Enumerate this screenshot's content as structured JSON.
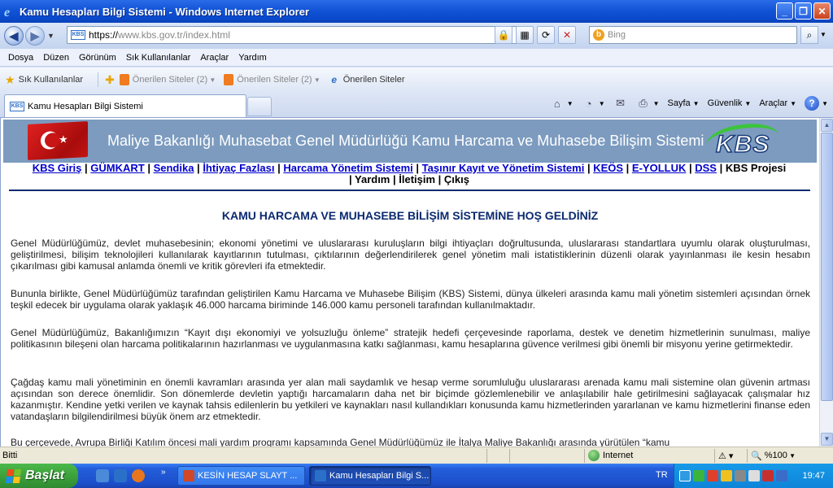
{
  "window": {
    "title": "Kamu Hesapları Bilgi Sistemi - Windows Internet Explorer",
    "min": "_",
    "max": "❐",
    "close": "✕"
  },
  "address": {
    "url_proto": "https://",
    "url_rest": "www.kbs.gov.tr/index.html",
    "search_placeholder": "Bing"
  },
  "menu": [
    "Dosya",
    "Düzen",
    "Görünüm",
    "Sık Kullanılanlar",
    "Araçlar",
    "Yardım"
  ],
  "favorites": {
    "label": "Sık Kullanılanlar",
    "items": [
      "Önerilen Siteler (2)",
      "Önerilen Siteler (2)",
      "Önerilen Siteler"
    ]
  },
  "tab": {
    "title": "Kamu Hesapları Bilgi Sistemi",
    "favicon": "KBS"
  },
  "commandbar": {
    "page": "Sayfa",
    "safety": "Güvenlik",
    "tools": "Araçlar",
    "help": "?"
  },
  "banner": {
    "title": "Maliye Bakanlığı Muhasebat Genel Müdürlüğü Kamu Harcama ve Muhasebe Bilişim Sistemi",
    "logo": "KBS"
  },
  "nav": {
    "links": [
      "KBS Giriş",
      "GÜMKART",
      "Sendika",
      "İhtiyaç Fazlası",
      "Harcama Yönetim Sistemi",
      "Taşınır Kayıt ve Yönetim Sistemi",
      "KEÖS",
      "E-YOLLUK",
      "DSS"
    ],
    "plain1": "KBS Projesi",
    "plain2": [
      "Yardım",
      "İletişim",
      "Çıkış"
    ],
    "sep": " | "
  },
  "welcome": "KAMU HARCAMA VE MUHASEBE BİLİŞİM SİSTEMİNE HOŞ GELDİNİZ",
  "paragraphs": [
    "Genel Müdürlüğümüz, devlet muhasebesinin; ekonomi yönetimi ve uluslararası kuruluşların bilgi ihtiyaçları doğrultusunda, uluslararası standartlara uyumlu olarak oluşturulması, geliştirilmesi, bilişim teknolojileri kullanılarak kayıtlarının tutulması, çıktılarının değerlendirilerek genel yönetim mali istatistiklerinin düzenli olarak yayınlanması ile kesin hesabın çıkarılması gibi kamusal anlamda önemli ve kritik görevleri ifa etmektedir.",
    "Bununla birlikte, Genel Müdürlüğümüz tarafından geliştirilen Kamu Harcama ve Muhasebe Bilişim (KBS) Sistemi, dünya ülkeleri arasında kamu mali yönetim sistemleri açısından örnek teşkil edecek bir uygulama olarak yaklaşık 46.000 harcama biriminde 146.000 kamu personeli tarafından kullanılmaktadır.",
    "Genel Müdürlüğümüz, Bakanlığımızın “Kayıt dışı ekonomiyi ve yolsuzluğu önleme” stratejik hedefi çerçevesinde raporlama, destek ve denetim hizmetlerinin sunulması, maliye politikasının bileşeni olan harcama politikalarının hazırlanması ve uygulanmasına katkı sağlanması, kamu hesaplarına güvence verilmesi gibi önemli bir misyonu yerine getirmektedir.",
    "Çağdaş kamu mali yönetiminin en önemli kavramları arasında yer alan mali saydamlık ve hesap verme sorumluluğu uluslararası arenada kamu mali sistemine olan güvenin artması açısından son derece önemlidir. Son dönemlerde devletin yaptığı harcamaların daha net bir biçimde gözlemlenebilir ve anlaşılabilir hale getirilmesini sağlayacak çalışmalar hız kazanmıştır. Kendine yetki verilen ve kaynak tahsis edilenlerin bu yetkileri ve kaynakları nasıl kullandıkları konusunda kamu hizmetlerinden yararlanan ve kamu hizmetlerini finanse eden vatandaşların bilgilendirilmesi büyük önem arz etmektedir.",
    "Bu çerçevede, Avrupa Birliği Katılım öncesi mali yardım programı kapsamında Genel Müdürlüğümüz ile İtalya Maliye Bakanlığı arasında yürütülen “kamu"
  ],
  "status": {
    "text": "Bitti",
    "zone": "Internet",
    "zoom": "%100"
  },
  "taskbar": {
    "start": "Başlat",
    "tasks": [
      "KESİN HESAP SLAYT ...",
      "Kamu Hesapları Bilgi S..."
    ],
    "lang": "TR",
    "clock": "19:47"
  }
}
